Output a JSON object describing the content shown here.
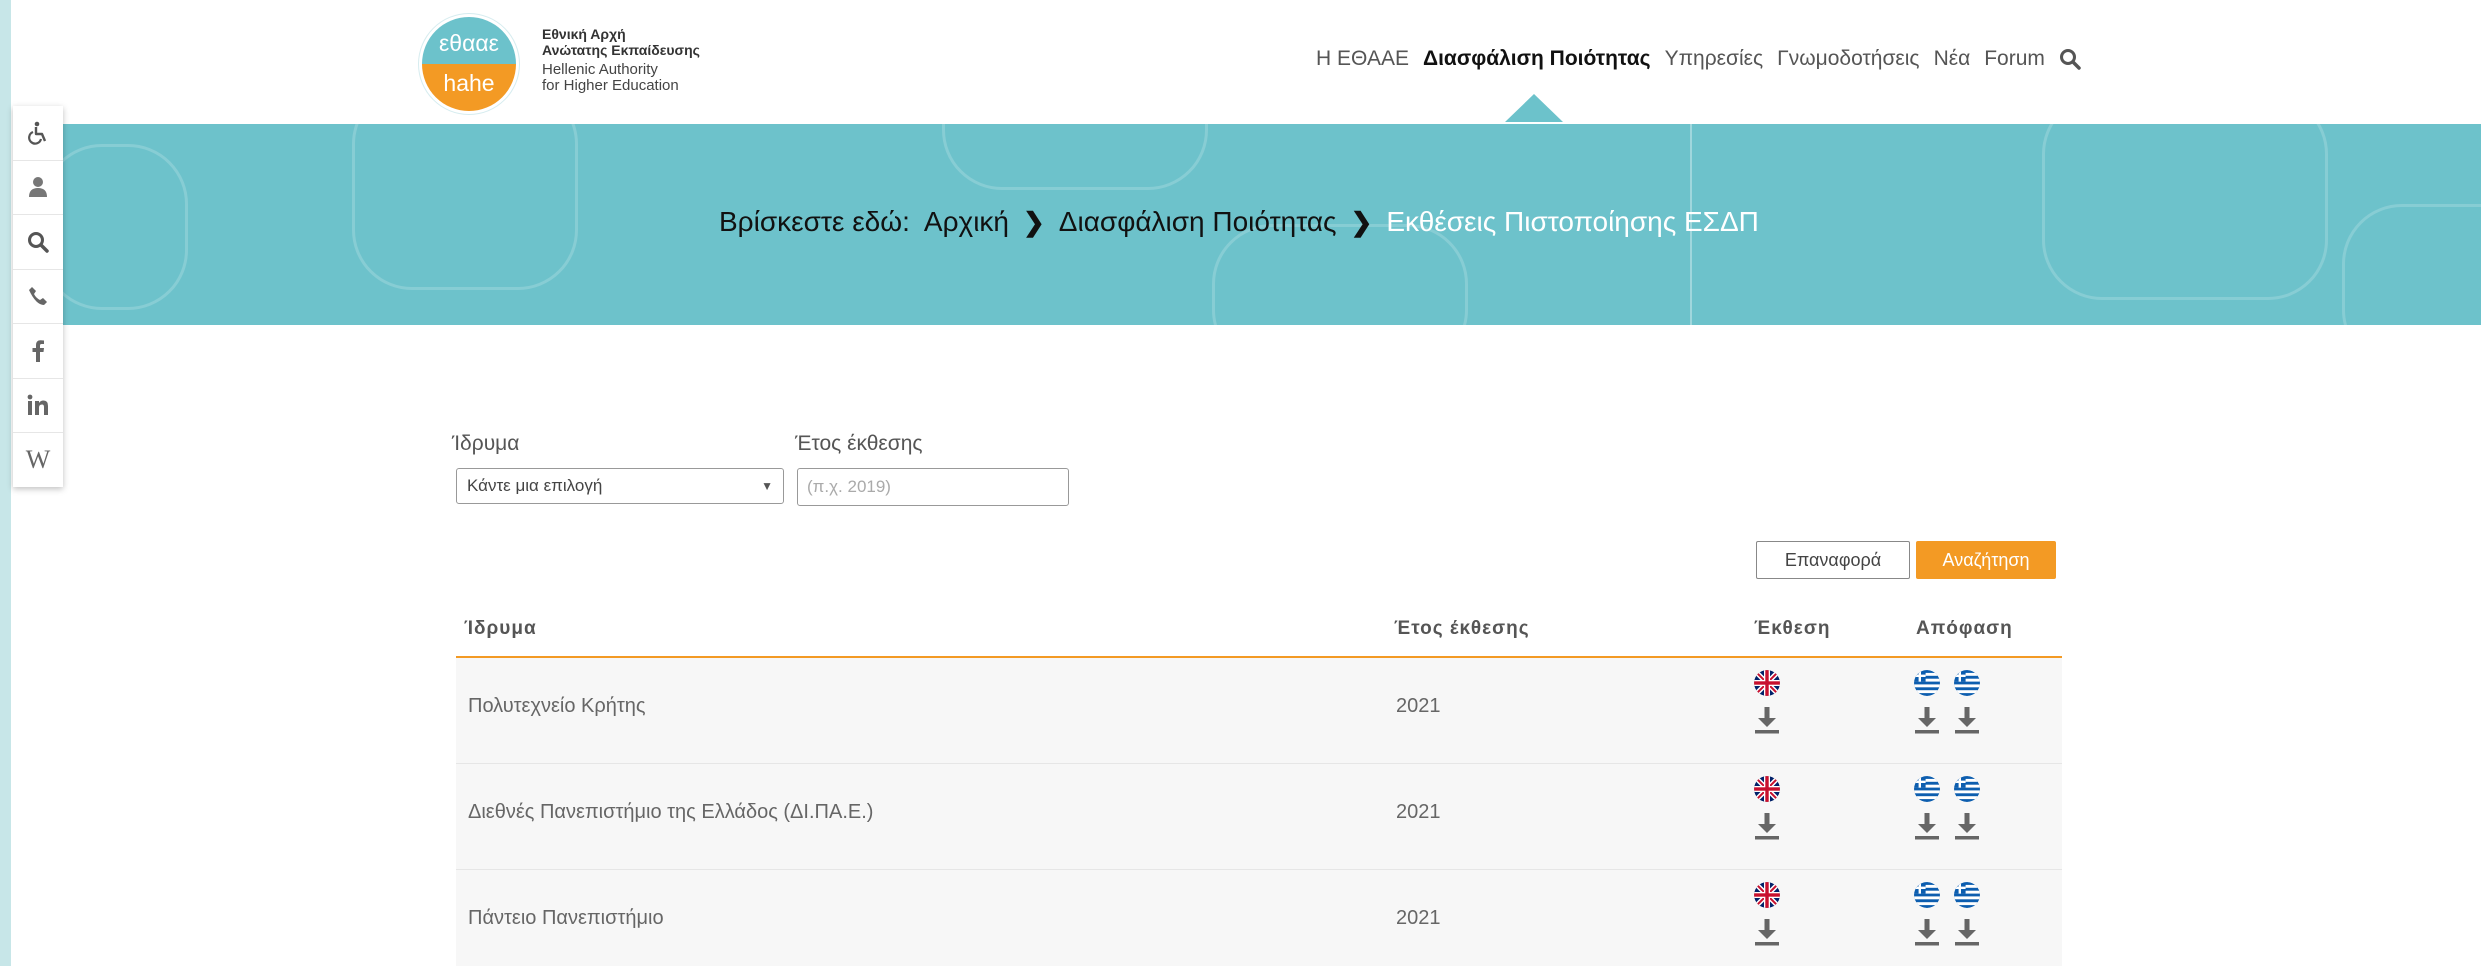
{
  "header": {
    "logo": {
      "top_text": "εθααε",
      "bottom_text": "hahe"
    },
    "org_name_gr_line1": "Εθνική Αρχή",
    "org_name_gr_line2": "Ανώτατης Εκπαίδευσης",
    "org_name_en_line1": "Hellenic Authority",
    "org_name_en_line2": "for Higher Education",
    "nav": [
      {
        "label": "Η ΕΘΑΑΕ",
        "active": false
      },
      {
        "label": "Διασφάλιση Ποιότητας",
        "active": true
      },
      {
        "label": "Υπηρεσίες",
        "active": false
      },
      {
        "label": "Γνωμοδοτήσεις",
        "active": false
      },
      {
        "label": "Νέα",
        "active": false
      },
      {
        "label": "Forum",
        "active": false
      }
    ],
    "search_icon": "search-icon"
  },
  "breadcrumb": {
    "prefix": "Βρίσκεστε εδώ:",
    "items": [
      "Αρχική",
      "Διασφάλιση Ποιότητας"
    ],
    "current": "Εκθέσεις Πιστοποίησης ΕΣΔΠ"
  },
  "sidebar_icons": [
    "accessibility-icon",
    "user-icon",
    "search-icon",
    "phone-icon",
    "facebook-icon",
    "linkedin-icon",
    "wikipedia-icon"
  ],
  "filters": {
    "institution_label": "Ίδρυμα",
    "institution_value": "Κάντε μια επιλογή",
    "year_label": "Έτος έκθεσης",
    "year_placeholder": "(π.χ. 2019)",
    "reset_label": "Επαναφορά",
    "search_label": "Αναζήτηση"
  },
  "table": {
    "headers": [
      "Ίδρυμα",
      "Έτος έκθεσης",
      "Έκθεση",
      "Απόφαση"
    ],
    "rows": [
      {
        "institution": "Πολυτεχνείο Κρήτης",
        "year": "2021"
      },
      {
        "institution": "Διεθνές Πανεπιστήμιο της Ελλάδος (ΔΙ.ΠΑ.Ε.)",
        "year": "2021"
      },
      {
        "institution": "Πάντειο Πανεπιστήμιο",
        "year": "2021"
      }
    ]
  },
  "colors": {
    "accent": "#f39a24",
    "teal": "#6cc2cb"
  }
}
